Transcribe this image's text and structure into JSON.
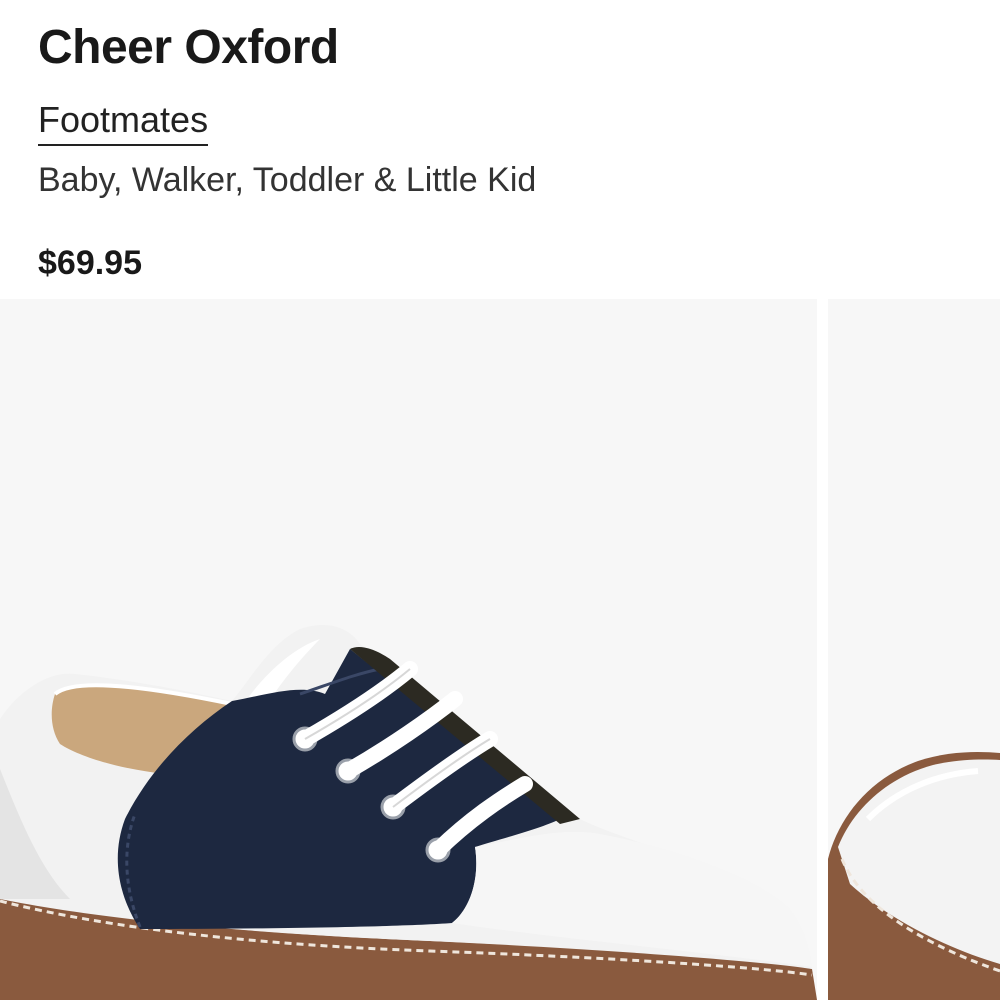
{
  "product": {
    "title": "Cheer Oxford",
    "brand": "Footmates",
    "subtitle": "Baby, Walker, Toddler & Little Kid",
    "price": "$69.95"
  },
  "gallery": {
    "images": [
      {
        "subject": "white-and-navy saddle oxford, side view"
      },
      {
        "subject": "white saddle oxford toe, partially visible"
      }
    ]
  },
  "colors": {
    "text": "#191919",
    "image_background": "#f7f7f7",
    "shoe_white": "#f3f3f3",
    "shoe_navy": "#1d2840",
    "sole_brown": "#8a5a3e",
    "insole_tan": "#caa77d"
  }
}
